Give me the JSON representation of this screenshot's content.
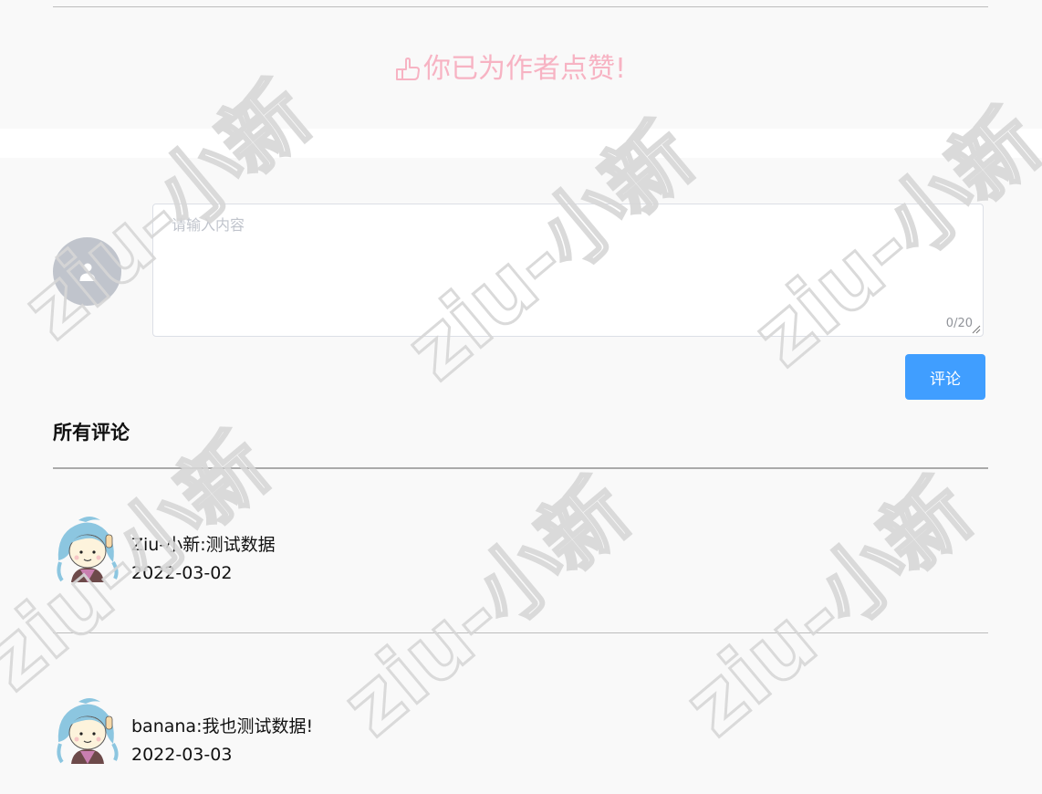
{
  "like": {
    "message": "你已为作者点赞!"
  },
  "comment_form": {
    "placeholder": "请输入内容",
    "value": "",
    "word_count": "0/20",
    "submit_label": "评论"
  },
  "comments_section": {
    "title": "所有评论"
  },
  "comments": [
    {
      "user": "Ziu-小新",
      "text": "测试数据",
      "date": "2022-03-02"
    },
    {
      "user": "banana",
      "text": "我也测试数据!",
      "date": "2022-03-03"
    }
  ],
  "watermark": {
    "text": "ziu-小新"
  },
  "colors": {
    "like_pink": "#f7b3c3",
    "primary_blue": "#409eff",
    "avatar_gray": "#c0c4cc",
    "background": "#f9f9f9"
  },
  "icons": [
    "thumb-up-icon",
    "user-icon",
    "resize-handle-icon",
    "cartoon-avatar"
  ]
}
